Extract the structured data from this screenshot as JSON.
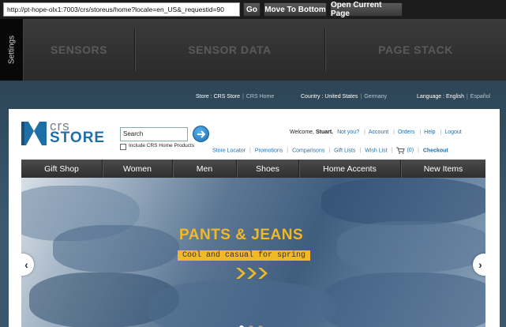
{
  "toolbar": {
    "url": "http://pt-hope-olx1:7003/crs/storeus/home?locale=en_US&_requestid=90",
    "go_label": "Go",
    "move_bottom_label": "Move To Bottom",
    "open_current_label": "Open Current Page"
  },
  "tools": {
    "settings_label": "Settings",
    "tabs": [
      "SENSORS",
      "SENSOR DATA",
      "PAGE STACK"
    ]
  },
  "utility": {
    "store_label": "Store :",
    "store_current": "CRS Store",
    "store_other": "CRS Home",
    "country_label": "Country :",
    "country_current": "United States",
    "country_other": "Germany",
    "language_label": "Language :",
    "language_current": "English",
    "language_other": "Español"
  },
  "logo": {
    "top": "crs",
    "bottom": "STORE"
  },
  "search": {
    "value": "Search",
    "include_label": "Include CRS Home Products"
  },
  "account": {
    "welcome": "Welcome,",
    "user": "Stuart.",
    "not_you": "Not you?",
    "links": [
      "Account",
      "Orders",
      "Help",
      "Logout"
    ]
  },
  "nav_links": [
    "Store Locator",
    "Promotions",
    "Comparisons",
    "Gift Lists",
    "Wish List"
  ],
  "cart": {
    "count": "(0)",
    "checkout": "Checkout"
  },
  "categories": [
    "Gift Shop",
    "Women",
    "Men",
    "Shoes",
    "Home Accents",
    "New Items"
  ],
  "hero": {
    "title": "PANTS & JEANS",
    "subtitle": "Cool and casual for spring",
    "arrows": "›››",
    "slides": 3,
    "active_slide": 1
  },
  "colors": {
    "accent_blue": "#1f6fa7",
    "hero_gold": "#f0b928",
    "catbar": "#3c3c3c"
  }
}
